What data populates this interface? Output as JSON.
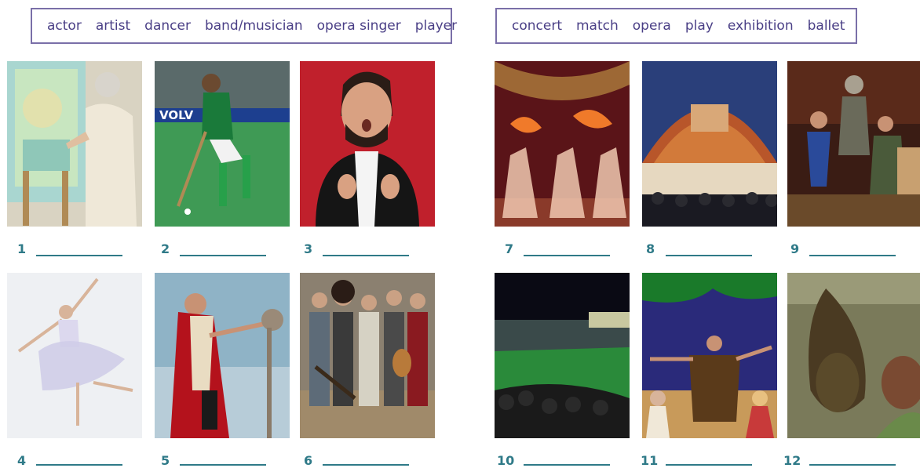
{
  "people_words": [
    "actor",
    "artist",
    "dancer",
    "band/musician",
    "opera singer",
    "player"
  ],
  "event_words": [
    "concert",
    "match",
    "opera",
    "play",
    "exhibition",
    "ballet"
  ],
  "items": [
    {
      "number": "1",
      "icon": "painter-photo"
    },
    {
      "number": "2",
      "icon": "hockey-player-photo"
    },
    {
      "number": "3",
      "icon": "opera-singer-photo"
    },
    {
      "number": "4",
      "icon": "ballerina-photo"
    },
    {
      "number": "5",
      "icon": "actor-costume-photo"
    },
    {
      "number": "6",
      "icon": "band-photo"
    },
    {
      "number": "7",
      "icon": "ballet-stage-photo"
    },
    {
      "number": "8",
      "icon": "concert-hall-photo"
    },
    {
      "number": "9",
      "icon": "theatre-play-photo"
    },
    {
      "number": "10",
      "icon": "stadium-match-photo"
    },
    {
      "number": "11",
      "icon": "opera-stage-photo"
    },
    {
      "number": "12",
      "icon": "exhibition-sculpture-photo"
    }
  ],
  "colors": {
    "accent": "#4a3f86",
    "number": "#2f7a88",
    "border": "#7a6fa8"
  }
}
